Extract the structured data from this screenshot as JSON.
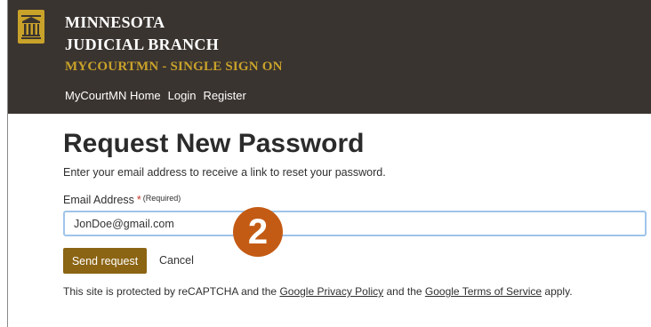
{
  "header": {
    "brand_line1": "MINNESOTA",
    "brand_line2": "JUDICIAL BRANCH",
    "brand_line3": "MYCOURTMN - SINGLE SIGN ON",
    "nav": [
      "MyCourtMN Home",
      "Login",
      "Register"
    ]
  },
  "page": {
    "title": "Request New Password",
    "subtitle": "Enter your email address to receive a link to reset your password."
  },
  "form": {
    "email_label": "Email Address",
    "required_star": "*",
    "required_note": "(Required)",
    "email_value": "JonDoe@gmail.com",
    "send_label": "Send request",
    "cancel_label": "Cancel"
  },
  "annotation": {
    "step_number": "2"
  },
  "recaptcha": {
    "prefix": "This site is protected by reCAPTCHA and the ",
    "privacy_link": "Google Privacy Policy",
    "middle": " and the ",
    "terms_link": "Google Terms of Service",
    "suffix": " apply."
  },
  "colors": {
    "header_bg": "#3a3430",
    "accent_gold": "#c9a22a",
    "button_bg": "#8b6414",
    "badge_bg": "#c45b14",
    "input_focus_border": "#9fc4ea"
  }
}
